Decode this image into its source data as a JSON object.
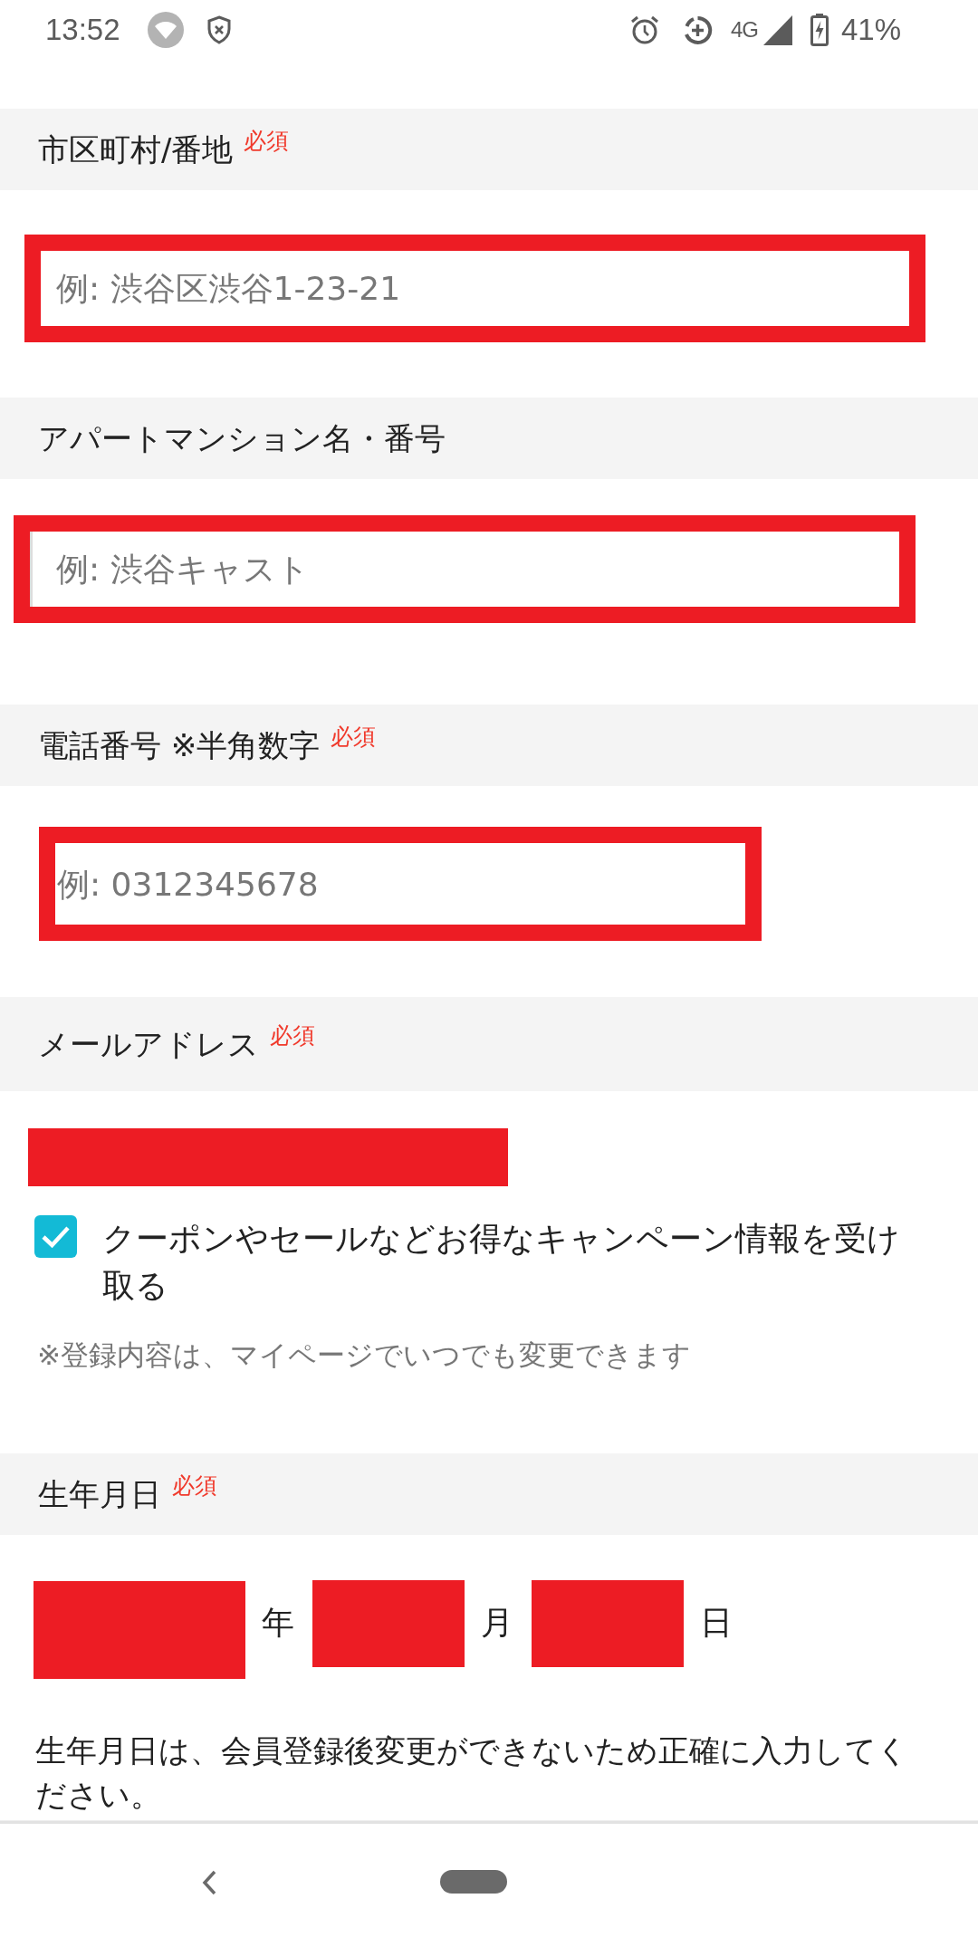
{
  "status_bar": {
    "time": "13:52",
    "network": "4G",
    "battery": "41%"
  },
  "sections": [
    {
      "kind": "text",
      "label": "市区町村/番地",
      "badge": "必須",
      "field": {
        "placeholder": "例: 渋谷区渋谷1-23-21"
      }
    },
    {
      "kind": "text",
      "label": "アパートマンション名・番号",
      "field": {
        "placeholder": "例: 渋谷キャスト"
      }
    },
    {
      "kind": "tel",
      "label": "電話番号 ※半角数字",
      "badge": "必須",
      "field": {
        "placeholder": "例: 0312345678"
      }
    },
    {
      "kind": "email",
      "label": "メールアドレス",
      "badge": "必須",
      "checkbox": {
        "label": "クーポンやセールなどお得なキャンペーン情報を受け取る",
        "checked": true
      },
      "note": "※登録内容は、マイページでいつでも変更できます"
    },
    {
      "kind": "date",
      "label": "生年月日",
      "badge": "必須",
      "units": [
        "年",
        "月",
        "日"
      ],
      "note": "生年月日は、会員登録後変更ができないため正確に入力してください。"
    }
  ]
}
